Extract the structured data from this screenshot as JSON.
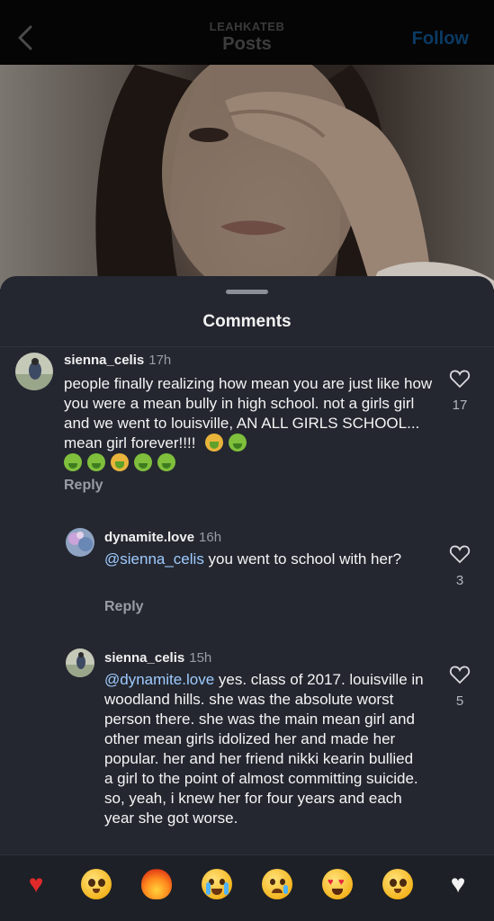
{
  "header": {
    "username": "LEAHKATEB",
    "title": "Posts",
    "follow_label": "Follow"
  },
  "sheet": {
    "title": "Comments"
  },
  "comments": [
    {
      "username": "sienna_celis",
      "time": "17h",
      "text": "people finally realizing how mean you are just like how you were a mean bully in high school. not a girls girl and we went to louisville, AN ALL GIRLS SCHOOL... mean girl forever!!!!",
      "reply_label": "Reply",
      "likes": "17"
    },
    {
      "username": "dynamite.love",
      "time": "16h",
      "mention": "@sienna_celis",
      "text": " you went to school with her?",
      "reply_label": "Reply",
      "likes": "3"
    },
    {
      "username": "sienna_celis",
      "time": "15h",
      "mention": "@dynamite.love",
      "text": " yes. class of 2017. louisville in woodland hills. she was the absolute worst person there. she was the main mean girl and other mean girls idolized her and made her popular. her and her friend nikki kearin bullied a girl to the point of almost committing suicide. so, yeah, i knew her for four years and each year she got worse.",
      "likes": "5"
    }
  ],
  "reactions": [
    "red-heart",
    "pleading-face",
    "fire",
    "loudly-crying-face",
    "crying-face",
    "heart-eyes-face",
    "pleading-face",
    "white-heart"
  ],
  "colors": {
    "sheet_bg": "#242730",
    "mention": "#9ecbff",
    "follow": "#0b3a63"
  }
}
